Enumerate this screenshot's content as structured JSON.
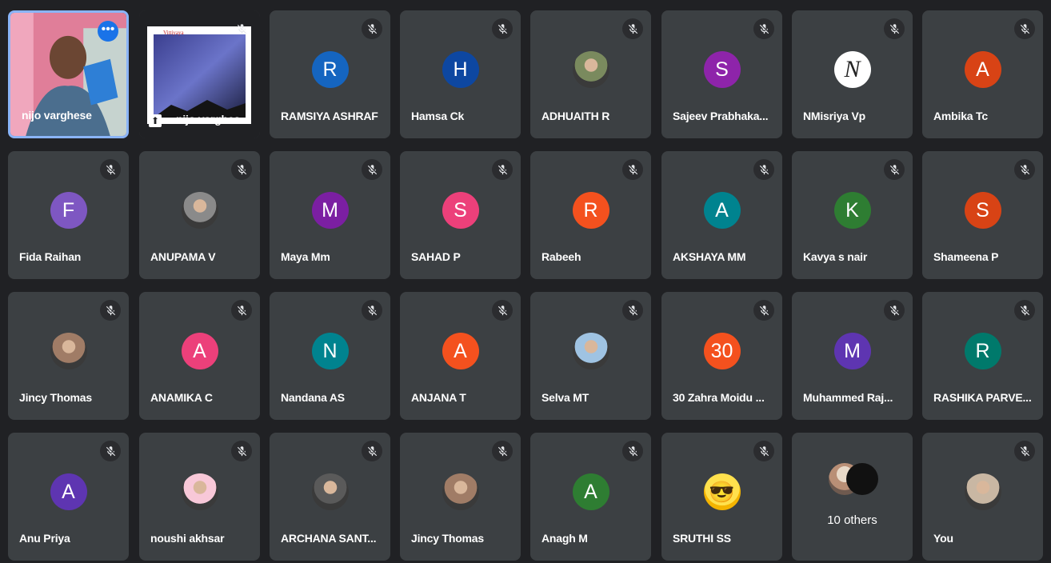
{
  "tiles": [
    {
      "name": "nijo varghese",
      "type": "video"
    },
    {
      "name": "nijo varghes",
      "type": "screen"
    },
    {
      "name": "RAMSIYA ASHRAF",
      "initial": "R",
      "color": "#1565c0"
    },
    {
      "name": "Hamsa Ck",
      "initial": "H",
      "color": "#0d47a1"
    },
    {
      "name": "ADHUAITH R",
      "initial": "",
      "color": "#7a8a5e"
    },
    {
      "name": "Sajeev Prabhaka...",
      "initial": "S",
      "color": "#8e24aa"
    },
    {
      "name": "NMisriya Vp",
      "initial": "",
      "color": "#ffffff"
    },
    {
      "name": "Ambika Tc",
      "initial": "A",
      "color": "#d84315"
    },
    {
      "name": "Fida Raihan",
      "initial": "F",
      "color": "#7e57c2"
    },
    {
      "name": "ANUPAMA V",
      "initial": "",
      "color": "#8a8a8a"
    },
    {
      "name": "Maya Mm",
      "initial": "M",
      "color": "#7b1fa2"
    },
    {
      "name": "SAHAD P",
      "initial": "S",
      "color": "#ec407a"
    },
    {
      "name": "Rabeeh",
      "initial": "R",
      "color": "#f4511e"
    },
    {
      "name": "AKSHAYA MM",
      "initial": "A",
      "color": "#00838f"
    },
    {
      "name": "Kavya s nair",
      "initial": "K",
      "color": "#2e7d32"
    },
    {
      "name": "Shameena P",
      "initial": "S",
      "color": "#d84315"
    },
    {
      "name": "Jincy Thomas",
      "initial": "",
      "color": "#a07c66"
    },
    {
      "name": "ANAMIKA C",
      "initial": "A",
      "color": "#ec407a"
    },
    {
      "name": "Nandana AS",
      "initial": "N",
      "color": "#00838f"
    },
    {
      "name": "ANJANA T",
      "initial": "A",
      "color": "#f4511e"
    },
    {
      "name": "Selva MT",
      "initial": "",
      "color": "#9fc3e2"
    },
    {
      "name": "30 Zahra Moidu ...",
      "initial": "30",
      "color": "#f4511e"
    },
    {
      "name": "Muhammed Raj...",
      "initial": "M",
      "color": "#5e35b1"
    },
    {
      "name": "RASHIKA PARVE...",
      "initial": "R",
      "color": "#00796b"
    },
    {
      "name": "Anu Priya",
      "initial": "A",
      "color": "#5e35b1"
    },
    {
      "name": "noushi akhsar",
      "initial": "",
      "color": "#f8c8d8"
    },
    {
      "name": "ARCHANA SANT...",
      "initial": "",
      "color": "#5a5a5a"
    },
    {
      "name": "Jincy Thomas",
      "initial": "",
      "color": "#a07c66"
    },
    {
      "name": "Anagh M",
      "initial": "A",
      "color": "#2e7d32"
    },
    {
      "name": "SRUTHI SS",
      "initial": "",
      "color": "#f9d71c"
    },
    {
      "name": "",
      "type": "others",
      "label": "10 others"
    },
    {
      "name": "You",
      "initial": "",
      "color": "#c9b7a3"
    }
  ],
  "screen_share": {
    "title": "Vittiyaya"
  }
}
